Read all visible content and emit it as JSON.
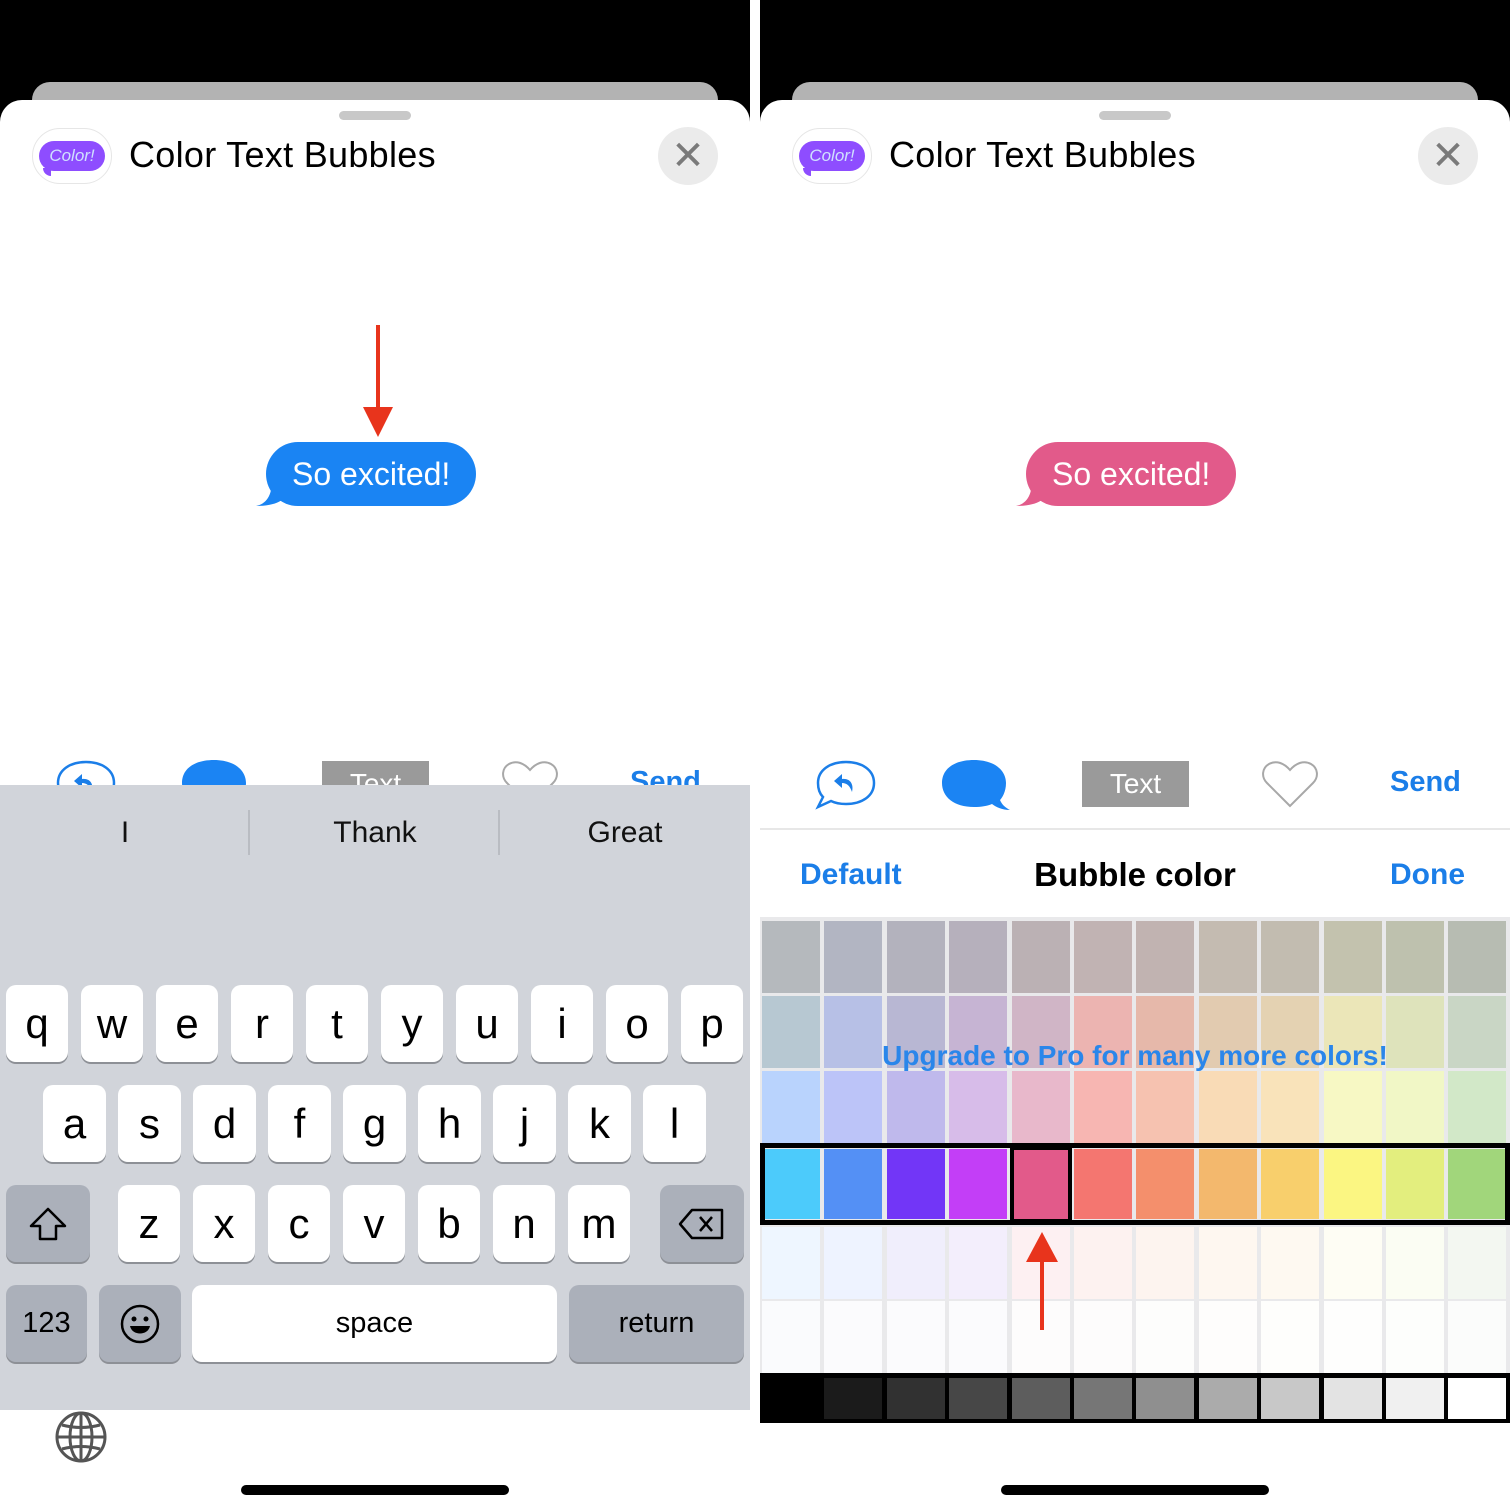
{
  "app": {
    "title": "Color Text Bubbles",
    "icon_label": "Color!",
    "close_icon": "close-icon"
  },
  "left": {
    "bubble_text": "So excited!",
    "bubble_color": "#1a84f3",
    "toolbar": {
      "reply_icon": "reply-bubble-icon",
      "bubble_icon": "bubble-color-icon",
      "text_label": "Text",
      "heart_icon": "heart-icon",
      "send_label": "Send"
    },
    "keyboard": {
      "suggestions": [
        "I",
        "Thank",
        "Great"
      ],
      "row1": [
        "q",
        "w",
        "e",
        "r",
        "t",
        "y",
        "u",
        "i",
        "o",
        "p"
      ],
      "row2": [
        "a",
        "s",
        "d",
        "f",
        "g",
        "h",
        "j",
        "k",
        "l"
      ],
      "row3": [
        "z",
        "x",
        "c",
        "v",
        "b",
        "n",
        "m"
      ],
      "numbers_label": "123",
      "space_label": "space",
      "return_label": "return"
    }
  },
  "right": {
    "bubble_text": "So excited!",
    "bubble_color": "#e25a8a",
    "toolbar": {
      "text_label": "Text",
      "send_label": "Send"
    },
    "picker": {
      "default_label": "Default",
      "title": "Bubble color",
      "done_label": "Done",
      "upgrade_text": "Upgrade to Pro for many more colors!",
      "selected_index": 4,
      "rows": [
        [
          "#b5b9bd",
          "#b2b5c2",
          "#b3b2bd",
          "#b6b0bc",
          "#bbb1b4",
          "#c1b3b3",
          "#c1b3b1",
          "#c4bbb1",
          "#c2bcb0",
          "#c3c2ae",
          "#bec1ae",
          "#b7bcb2"
        ],
        [
          "#b7c8d2",
          "#b7c0e6",
          "#b8b7d3",
          "#c6b4d3",
          "#d0b5c6",
          "#ecb4b1",
          "#e6b8aa",
          "#e2cbb0",
          "#e4d2b2",
          "#ebe6b8",
          "#dee3bb",
          "#c9d6c5"
        ],
        [
          "#b9d3fd",
          "#bcc4f8",
          "#bfb9ec",
          "#d7bce9",
          "#e8b8cb",
          "#f7b6b2",
          "#f6c2b0",
          "#f9dbb6",
          "#f9e3ba",
          "#f7f8c4",
          "#f1f7c6",
          "#d2e8c8"
        ],
        [
          "#4ccbfb",
          "#5490f5",
          "#7236f7",
          "#c33ef7",
          "#e25a8a",
          "#f47670",
          "#f48f6c",
          "#f3b86d",
          "#f8cf6c",
          "#fbf682",
          "#e3ee7e",
          "#a1d67b"
        ],
        [
          "#eef6ff",
          "#eef3ff",
          "#f0eefc",
          "#f3eefc",
          "#fdf0f2",
          "#fdf2f0",
          "#fdf4ef",
          "#fef7f0",
          "#fef9f1",
          "#fefdf4",
          "#fbfdf3",
          "#f3f7f1"
        ],
        [
          "#fafbfd",
          "#fbfbfd",
          "#fbfbfd",
          "#fbfbfd",
          "#fdfcfc",
          "#fdfcfc",
          "#fdfdfc",
          "#fefdfc",
          "#fefefc",
          "#fefefd",
          "#fdfefc",
          "#fbfcfb"
        ]
      ],
      "grays": [
        "#000000",
        "#1b1b1b",
        "#313131",
        "#474747",
        "#5d5d5d",
        "#767676",
        "#8f8f8f",
        "#ababab",
        "#c8c8c8",
        "#e3e3e3",
        "#f0f0f0",
        "#ffffff"
      ]
    }
  },
  "annotation_color": "#e8341c"
}
